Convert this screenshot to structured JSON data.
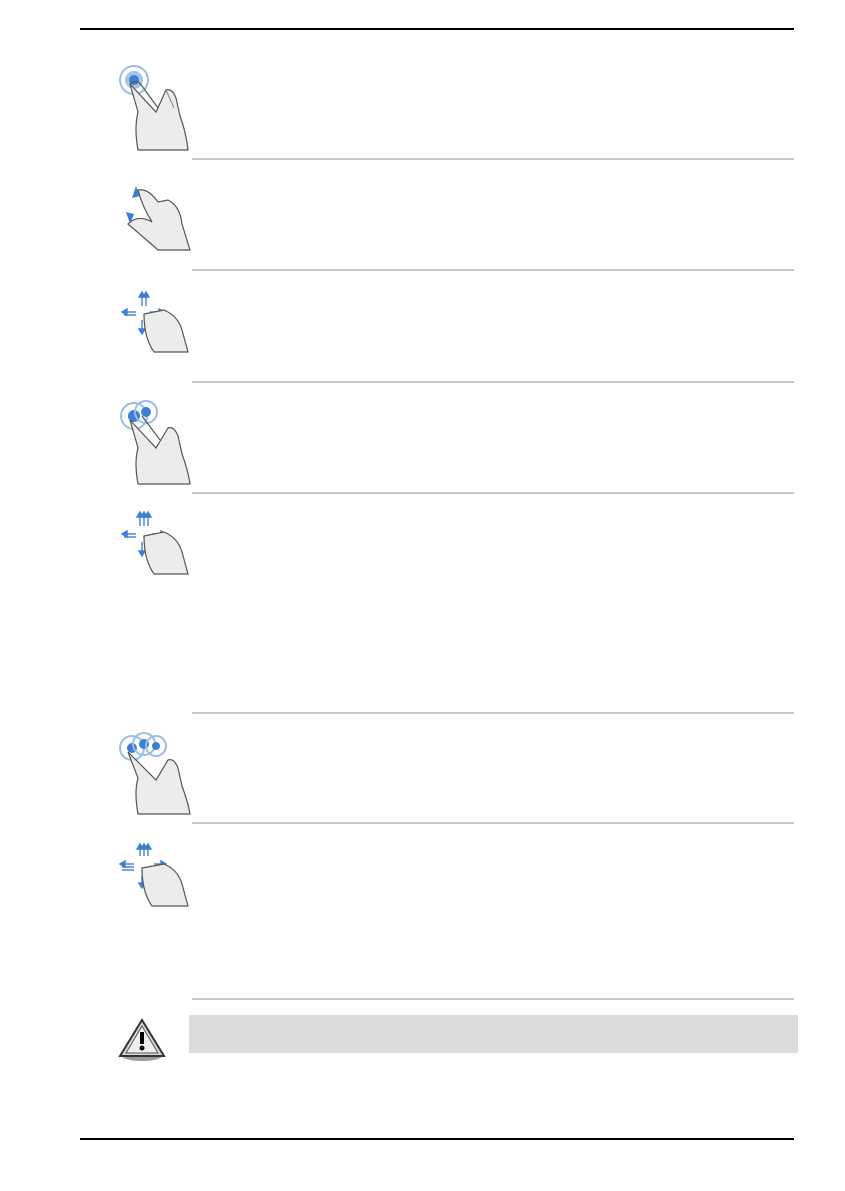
{
  "document": {
    "header_text": "",
    "footer_left": "",
    "footer_right": "",
    "gestures": [
      {
        "icon": "one-finger-tap-icon",
        "label": ""
      },
      {
        "icon": "pinch-zoom-icon",
        "label": ""
      },
      {
        "icon": "two-finger-scroll-icon",
        "label": ""
      },
      {
        "icon": "two-finger-tap-icon",
        "label": ""
      },
      {
        "icon": "three-finger-swipe-icon",
        "label": ""
      },
      {
        "icon": "three-finger-tap-icon",
        "label": ""
      },
      {
        "icon": "four-finger-swipe-icon",
        "label": ""
      }
    ],
    "caution": {
      "icon": "warning-icon",
      "text": ""
    }
  },
  "colors": {
    "accent": "#3f7fd2",
    "hand": "#d8d8d8",
    "divider": "#c8c8c8",
    "note_bg": "#dcdcdc"
  }
}
